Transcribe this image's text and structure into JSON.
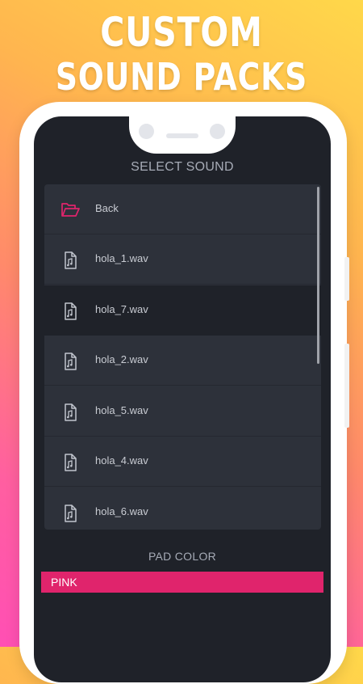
{
  "promo": {
    "line1": "CUSTOM",
    "line2": "SOUND PACKS"
  },
  "screen": {
    "select_title": "SELECT SOUND",
    "items": [
      {
        "label": "Back",
        "icon": "folder-open-icon"
      },
      {
        "label": "hola_1.wav",
        "icon": "audio-file-icon"
      },
      {
        "label": "hola_7.wav",
        "icon": "audio-file-icon",
        "selected": true
      },
      {
        "label": "hola_2.wav",
        "icon": "audio-file-icon"
      },
      {
        "label": "hola_5.wav",
        "icon": "audio-file-icon"
      },
      {
        "label": "hola_4.wav",
        "icon": "audio-file-icon"
      },
      {
        "label": "hola_6.wav",
        "icon": "audio-file-icon"
      }
    ],
    "pad_color_title": "PAD COLOR",
    "pad_color_value": "PINK"
  },
  "colors": {
    "accent": "#e0246c",
    "background": "#1f2229",
    "list_bg": "#2d313a"
  }
}
